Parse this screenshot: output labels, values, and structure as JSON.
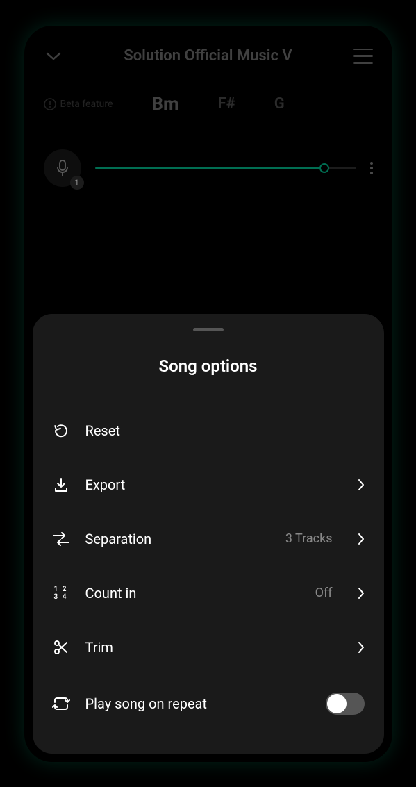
{
  "header": {
    "title": "Solution Official Music V"
  },
  "chords": {
    "beta_label": "Beta feature",
    "main_chord": "Bm",
    "secondary1": "F#",
    "secondary2": "G"
  },
  "player": {
    "mic_badge": "1"
  },
  "sheet": {
    "title": "Song options",
    "options": {
      "reset": {
        "label": "Reset"
      },
      "export": {
        "label": "Export"
      },
      "separation": {
        "label": "Separation",
        "value": "3 Tracks"
      },
      "countin": {
        "label": "Count in",
        "value": "Off",
        "icon_text": "1 2\n3 4"
      },
      "trim": {
        "label": "Trim"
      },
      "repeat": {
        "label": "Play song on repeat"
      }
    }
  }
}
